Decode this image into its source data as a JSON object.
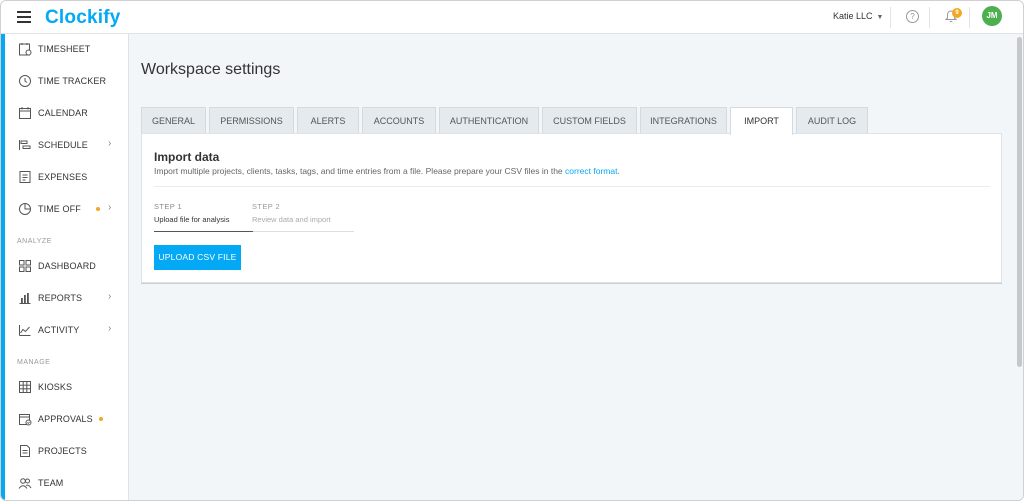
{
  "app": {
    "logo_text": "lockify",
    "logo_mark": "C",
    "workspace_name": "Katie LLC",
    "notification_count": "9",
    "avatar_initials": "JM",
    "help_glyph": "?"
  },
  "sidebar": {
    "items_top": [
      {
        "label": "TIMESHEET",
        "icon": "timesheet-icon"
      },
      {
        "label": "TIME TRACKER",
        "icon": "clock-icon"
      },
      {
        "label": "CALENDAR",
        "icon": "calendar-icon"
      },
      {
        "label": "SCHEDULE",
        "icon": "schedule-icon",
        "chevron": true
      },
      {
        "label": "EXPENSES",
        "icon": "expenses-icon"
      },
      {
        "label": "TIME OFF",
        "icon": "time-off-icon",
        "chevron": true,
        "dot": true
      }
    ],
    "analyze_label": "ANALYZE",
    "items_analyze": [
      {
        "label": "DASHBOARD",
        "icon": "dashboard-icon"
      },
      {
        "label": "REPORTS",
        "icon": "reports-icon",
        "chevron": true
      },
      {
        "label": "ACTIVITY",
        "icon": "activity-icon",
        "chevron": true
      }
    ],
    "manage_label": "MANAGE",
    "items_manage": [
      {
        "label": "KIOSKS",
        "icon": "kiosks-icon"
      },
      {
        "label": "APPROVALS",
        "icon": "approvals-icon",
        "dot": true
      },
      {
        "label": "PROJECTS",
        "icon": "projects-icon"
      },
      {
        "label": "TEAM",
        "icon": "team-icon"
      }
    ]
  },
  "main": {
    "title": "Workspace settings",
    "tabs": [
      "GENERAL",
      "PERMISSIONS",
      "ALERTS",
      "ACCOUNTS",
      "AUTHENTICATION",
      "CUSTOM FIELDS",
      "INTEGRATIONS",
      "IMPORT",
      "AUDIT LOG"
    ],
    "active_tab": "IMPORT",
    "import": {
      "heading": "Import data",
      "description": "Import multiple projects, clients, tasks, tags, and time entries from a file. Please prepare your CSV files in the ",
      "link_text": "correct format",
      "description_end": ".",
      "step1_num": "STEP 1",
      "step1_text": "Upload file for analysis",
      "step2_num": "STEP 2",
      "step2_text": "Review data and import",
      "upload_button": "UPLOAD CSV FILE"
    }
  },
  "colors": {
    "accent": "#03a9f4",
    "badge": "#f5a623",
    "avatar": "#4caf50"
  }
}
